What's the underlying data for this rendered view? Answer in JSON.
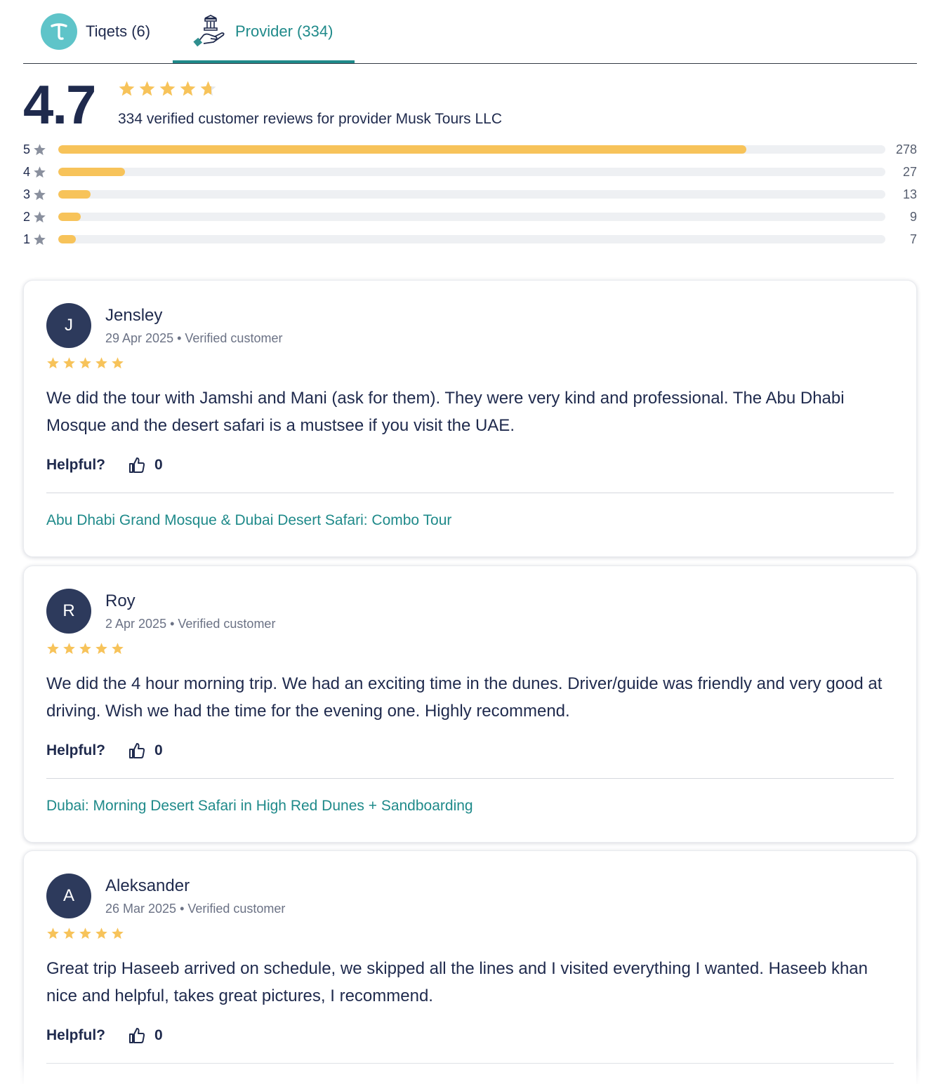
{
  "tabs": [
    {
      "label": "Tiqets (6)",
      "icon": "tiqets-logo-icon"
    },
    {
      "label": "Provider (334)",
      "icon": "provider-handshake-icon",
      "active": true
    }
  ],
  "summary": {
    "score": "4.7",
    "rating": 4.7,
    "text": "334 verified customer reviews for provider Musk Tours LLC"
  },
  "distribution": [
    {
      "label": "5",
      "count": "278",
      "value": 278
    },
    {
      "label": "4",
      "count": "27",
      "value": 27
    },
    {
      "label": "3",
      "count": "13",
      "value": 13
    },
    {
      "label": "2",
      "count": "9",
      "value": 9
    },
    {
      "label": "1",
      "count": "7",
      "value": 7
    }
  ],
  "reviews": [
    {
      "initial": "J",
      "name": "Jensley",
      "meta": "29 Apr 2025 • Verified customer",
      "rating": 5,
      "text": "We did the tour with Jamshi and Mani (ask for them). They were very kind and professional. The Abu Dhabi Mosque and the desert safari is a mustsee if you visit the UAE.",
      "helpful_label": "Helpful?",
      "helpful_count": "0",
      "product": "Abu Dhabi Grand Mosque & Dubai Desert Safari: Combo Tour"
    },
    {
      "initial": "R",
      "name": "Roy",
      "meta": "2 Apr 2025 • Verified customer",
      "rating": 5,
      "text": "We did the 4 hour morning trip. We had an exciting time in the dunes. Driver/guide was friendly and very good at driving. Wish we had the time for the evening one. Highly recommend.",
      "helpful_label": "Helpful?",
      "helpful_count": "0",
      "product": "Dubai: Morning Desert Safari in High Red Dunes + Sandboarding"
    },
    {
      "initial": "A",
      "name": "Aleksander",
      "meta": "26 Mar 2025 • Verified customer",
      "rating": 5,
      "text": "Great trip Haseeb arrived on schedule, we skipped all the lines and I visited everything I wanted. Haseeb khan nice and helpful, takes great pictures, I recommend.",
      "helpful_label": "Helpful?",
      "helpful_count": "0",
      "product": ""
    }
  ],
  "colors": {
    "accent": "#1f8a8a",
    "star": "#f7c35a",
    "star_empty": "#e3e6ea",
    "navy": "#1f2a4d",
    "avatar": "#2d3a5c"
  }
}
